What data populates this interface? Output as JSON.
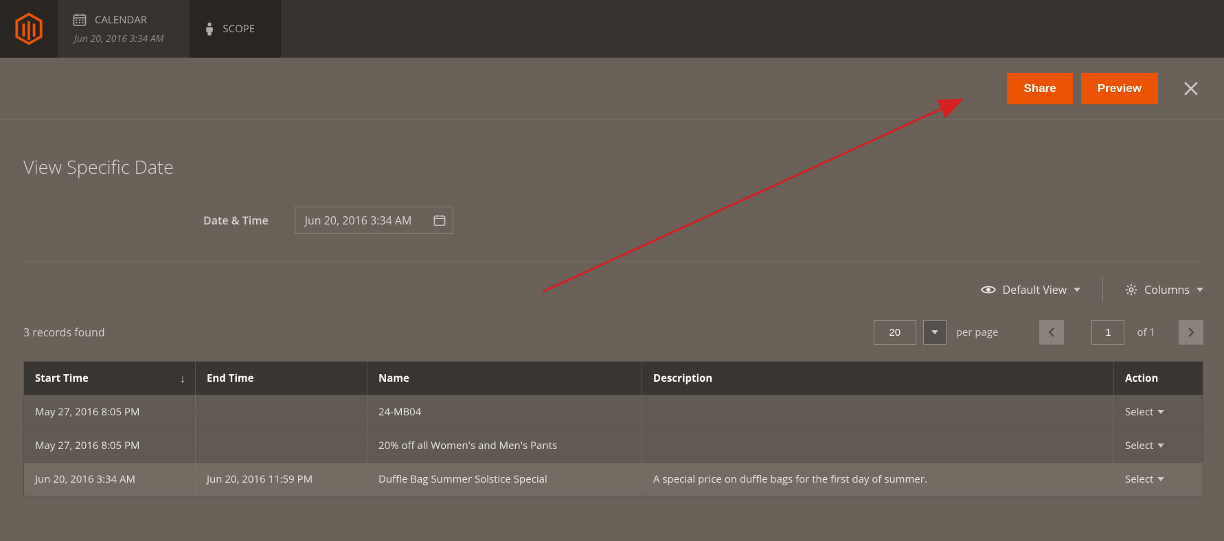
{
  "tabs": {
    "calendar_label": "CALENDAR",
    "calendar_sub": "Jun 20, 2016 3:34 AM",
    "scope_label": "SCOPE"
  },
  "header": {
    "share": "Share",
    "preview": "Preview"
  },
  "page": {
    "title": "View Specific Date",
    "date_label": "Date & Time",
    "date_value": "Jun 20, 2016 3:34 AM"
  },
  "toolbar": {
    "view_label": "Default View",
    "columns_label": "Columns"
  },
  "records": {
    "found_text": "3 records found",
    "per_page_value": "20",
    "per_page_label": "per page",
    "page_value": "1",
    "page_total_label": "of 1"
  },
  "table": {
    "headers": {
      "start": "Start Time",
      "end": "End Time",
      "name": "Name",
      "desc": "Description",
      "action": "Action"
    },
    "rows": [
      {
        "start": "May 27, 2016 8:05 PM",
        "end": "",
        "name": "24-MB04",
        "desc": "",
        "action": "Select",
        "hl": false
      },
      {
        "start": "May 27, 2016 8:05 PM",
        "end": "",
        "name": "20% off all Women's and Men's Pants",
        "desc": "",
        "action": "Select",
        "hl": false
      },
      {
        "start": "Jun 20, 2016 3:34 AM",
        "end": "Jun 20, 2016 11:59 PM",
        "name": "Duffle Bag Summer Solstice Special",
        "desc": "A special price on duffle bags for the first day of summer.",
        "action": "Select",
        "hl": true
      }
    ]
  }
}
